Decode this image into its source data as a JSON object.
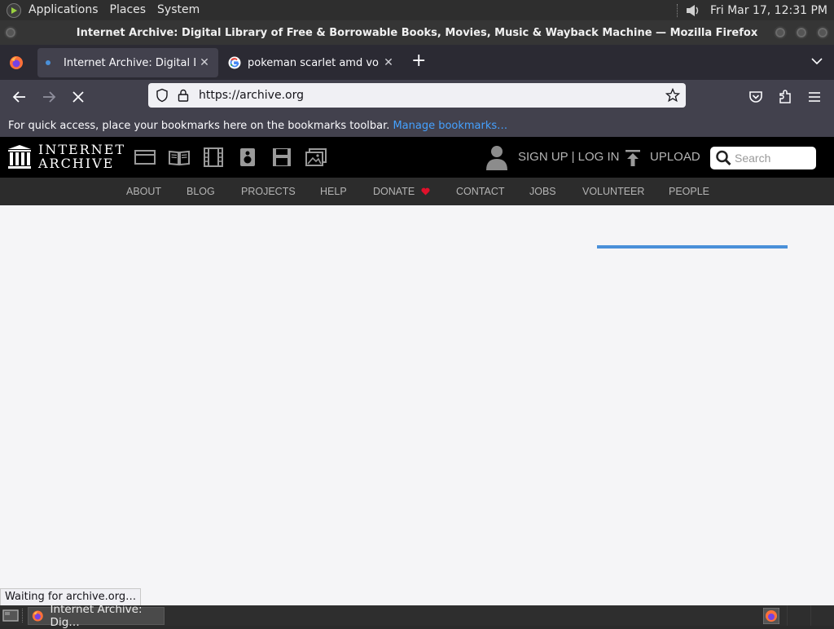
{
  "panel": {
    "applications": "Applications",
    "places": "Places",
    "system": "System",
    "clock": "Fri Mar 17, 12:31 PM"
  },
  "window": {
    "title": "Internet Archive: Digital Library of Free & Borrowable Books, Movies, Music & Wayback Machine — Mozilla Firefox"
  },
  "tabs": [
    {
      "label": "Internet Archive: Digital Library of Free & Borrowable Books",
      "active": true
    },
    {
      "label": "pokeman scarlet amd voilet",
      "active": false
    }
  ],
  "navbar": {
    "url": "https://archive.org"
  },
  "bookmarks": {
    "message": "For quick access, place your bookmarks here on the bookmarks toolbar.",
    "manage_link": "Manage bookmarks…"
  },
  "ia": {
    "logo_line1": "INTERNET",
    "logo_line2": "ARCHIVE",
    "signup": "SIGN UP | LOG IN",
    "upload": "UPLOAD",
    "search_placeholder": "Search",
    "nav": [
      "ABOUT",
      "BLOG",
      "PROJECTS",
      "HELP",
      "DONATE",
      "CONTACT",
      "JOBS",
      "VOLUNTEER",
      "PEOPLE"
    ]
  },
  "status": "Waiting for archive.org…",
  "taskbar": {
    "task_label": "Internet Archive: Dig…"
  },
  "colors": {
    "accent_link": "#45a1ff",
    "donate_heart": "#e0112b",
    "progress": "#4a90d9"
  }
}
